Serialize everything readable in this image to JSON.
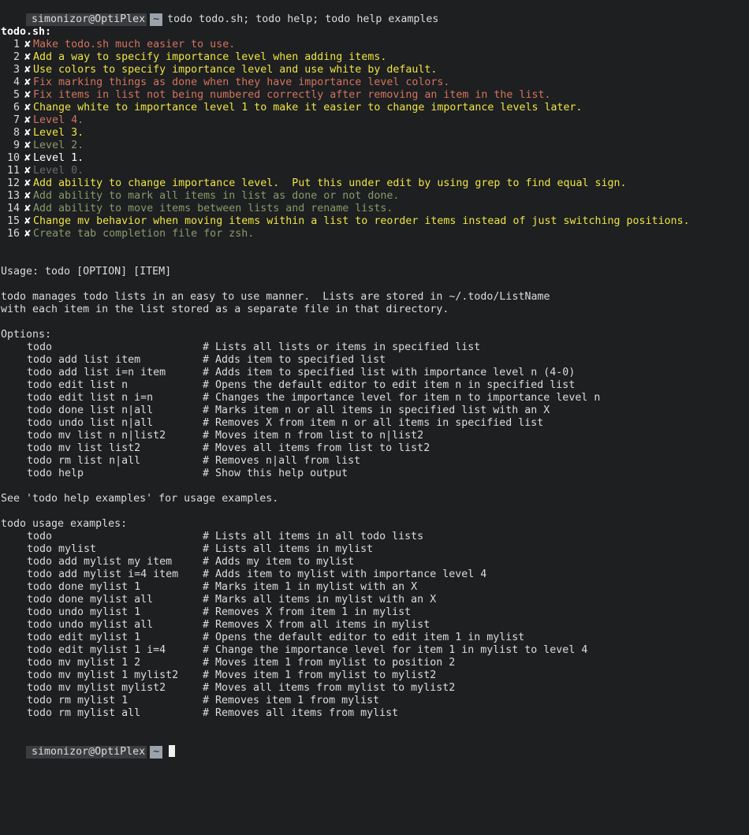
{
  "prompt": {
    "user": "simonizor@OptiPlex",
    "dir": "~",
    "command": "todo todo.sh; todo help; todo help examples"
  },
  "list": {
    "title": "todo.sh:",
    "mark": "✘",
    "items": [
      {
        "num": "1",
        "text": "Make todo.sh much easier to use.",
        "color": "#d4735e"
      },
      {
        "num": "2",
        "text": "Add a way to specify importance level when adding items.",
        "color": "#f0e442"
      },
      {
        "num": "3",
        "text": "Use colors to specify importance level and use white by default.",
        "color": "#f0e442"
      },
      {
        "num": "4",
        "text": "Fix marking things as done when they have importance level colors.",
        "color": "#d4735e"
      },
      {
        "num": "5",
        "text": "Fix items in list not being numbered correctly after removing an item in the list.",
        "color": "#d4735e"
      },
      {
        "num": "6",
        "text": "Change white to importance level 1 to make it easier to change importance levels later.",
        "color": "#f0e442"
      },
      {
        "num": "7",
        "text": "Level 4.",
        "color": "#d4735e"
      },
      {
        "num": "8",
        "text": "Level 3.",
        "color": "#f0e442"
      },
      {
        "num": "9",
        "text": "Level 2.",
        "color": "#8a9a6a"
      },
      {
        "num": "10",
        "text": "Level 1.",
        "color": "#ffffff"
      },
      {
        "num": "11",
        "text": "Level 0.",
        "color": "#6a6a6a"
      },
      {
        "num": "12",
        "text": "Add ability to change importance level.  Put this under edit by using grep to find equal sign.",
        "color": "#f0e442"
      },
      {
        "num": "13",
        "text": "Add ability to mark all items in list as done or not done.",
        "color": "#8a9a6a"
      },
      {
        "num": "14",
        "text": "Add ability to move items between lists and rename lists.",
        "color": "#8a9a6a"
      },
      {
        "num": "15",
        "text": "Change mv behavior when moving items within a list to reorder items instead of just switching positions.",
        "color": "#f0e442"
      },
      {
        "num": "16",
        "text": "Create tab completion file for zsh.",
        "color": "#8a9a6a"
      }
    ]
  },
  "help": {
    "usage": "Usage: todo [OPTION] [ITEM]",
    "desc1": "todo manages todo lists in an easy to use manner.  Lists are stored in ~/.todo/ListName",
    "desc2": "with each item in the list stored as a separate file in that directory.",
    "options_title": "Options:",
    "options": [
      {
        "cmd": "todo",
        "desc": "# Lists all lists or items in specified list"
      },
      {
        "cmd": "todo add list item",
        "desc": "# Adds item to specified list"
      },
      {
        "cmd": "todo add list i=n item",
        "desc": "# Adds item to specified list with importance level n (4-0)"
      },
      {
        "cmd": "todo edit list n",
        "desc": "# Opens the default editor to edit item n in specified list"
      },
      {
        "cmd": "todo edit list n i=n",
        "desc": "# Changes the importance level for item n to importance level n"
      },
      {
        "cmd": "todo done list n|all",
        "desc": "# Marks item n or all items in specified list with an X"
      },
      {
        "cmd": "todo undo list n|all",
        "desc": "# Removes X from item n or all items in specified list"
      },
      {
        "cmd": "todo mv list n n|list2",
        "desc": "# Moves item n from list to n|list2"
      },
      {
        "cmd": "todo mv list list2",
        "desc": "# Moves all items from list to list2"
      },
      {
        "cmd": "todo rm list n|all",
        "desc": "# Removes n|all from list"
      },
      {
        "cmd": "todo help",
        "desc": "# Show this help output"
      }
    ],
    "see_also": "See 'todo help examples' for usage examples."
  },
  "examples": {
    "title": "todo usage examples:",
    "rows": [
      {
        "cmd": "todo",
        "desc": "# Lists all items in all todo lists"
      },
      {
        "cmd": "todo mylist",
        "desc": "# Lists all items in mylist"
      },
      {
        "cmd": "todo add mylist my item",
        "desc": "# Adds my item to mylist"
      },
      {
        "cmd": "todo add mylist i=4 item",
        "desc": "# Adds item to mylist with importance level 4"
      },
      {
        "cmd": "todo done mylist 1",
        "desc": "# Marks item 1 in mylist with an X"
      },
      {
        "cmd": "todo done mylist all",
        "desc": "# Marks all items in mylist with an X"
      },
      {
        "cmd": "todo undo mylist 1",
        "desc": "# Removes X from item 1 in mylist"
      },
      {
        "cmd": "todo undo mylist all",
        "desc": "# Removes X from all items in mylist"
      },
      {
        "cmd": "todo edit mylist 1",
        "desc": "# Opens the default editor to edit item 1 in mylist"
      },
      {
        "cmd": "todo edit mylist 1 i=4",
        "desc": "# Change the importance level for item 1 in mylist to level 4"
      },
      {
        "cmd": "todo mv mylist 1 2",
        "desc": "# Moves item 1 from mylist to position 2"
      },
      {
        "cmd": "todo mv mylist 1 mylist2",
        "desc": "# Moves item 1 from mylist to mylist2"
      },
      {
        "cmd": "todo mv mylist mylist2",
        "desc": "# Moves all items from mylist to mylist2"
      },
      {
        "cmd": "todo rm mylist 1",
        "desc": "# Removes item 1 from mylist"
      },
      {
        "cmd": "todo rm mylist all",
        "desc": "# Removes all items from mylist"
      }
    ]
  },
  "final_prompt": {
    "user": "simonizor@OptiPlex",
    "dir": "~"
  }
}
